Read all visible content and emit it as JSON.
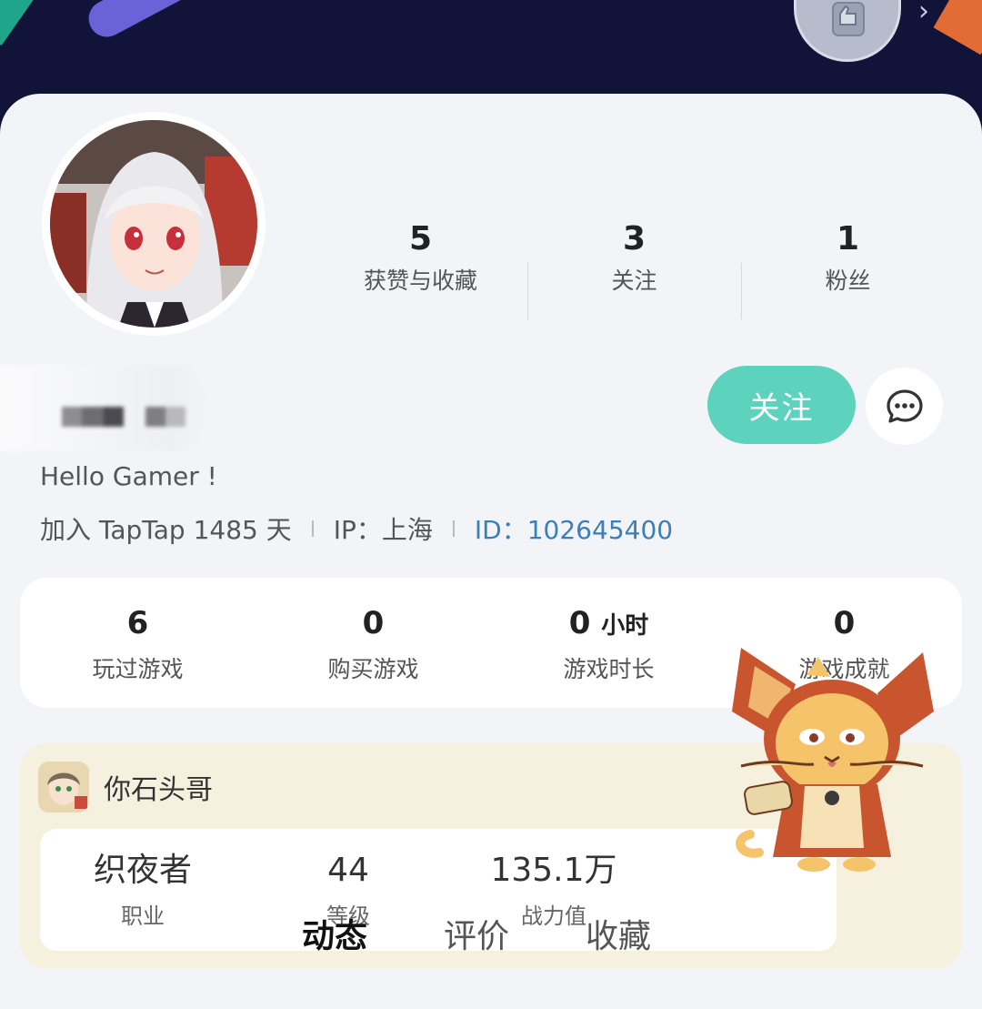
{
  "stats": [
    {
      "value": "5",
      "label": "获赞与收藏"
    },
    {
      "value": "3",
      "label": "关注"
    },
    {
      "value": "1",
      "label": "粉丝"
    }
  ],
  "actions": {
    "follow_label": "关注",
    "message_icon": "chat-bubble-icon"
  },
  "profile": {
    "bio": "Hello Gamer !",
    "joined": "加入 TapTap 1485 天",
    "ip": "IP：上海",
    "id": "ID：102645400"
  },
  "game_stats": [
    {
      "value": "6",
      "unit": "",
      "label": "玩过游戏"
    },
    {
      "value": "0",
      "unit": "",
      "label": "购买游戏"
    },
    {
      "value": "0",
      "unit": "小时",
      "label": "游戏时长"
    },
    {
      "value": "0",
      "unit": "",
      "label": "游戏成就"
    }
  ],
  "game_card": {
    "title": "你石头哥",
    "items": [
      {
        "value": "织夜者",
        "label": "职业"
      },
      {
        "value": "44",
        "label": "等级"
      },
      {
        "value": "135.1万",
        "label": "战力值"
      }
    ]
  },
  "tabs": [
    {
      "label": "动态",
      "active": true
    },
    {
      "label": "评价",
      "active": false
    },
    {
      "label": "收藏",
      "active": false
    }
  ],
  "colors": {
    "accent": "#5dd3be",
    "banner": "#111438",
    "id_link": "#3a7fb8"
  }
}
